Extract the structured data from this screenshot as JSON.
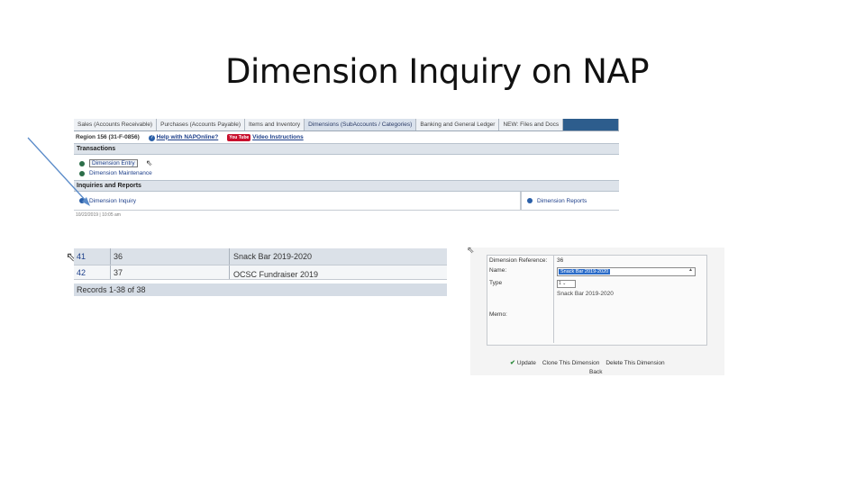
{
  "slide": {
    "title": "Dimension Inquiry on NAP"
  },
  "menu": {
    "tabs": [
      "Sales (Accounts Receivable)",
      "Purchases (Accounts Payable)",
      "Items and Inventory",
      "Dimensions (SubAccounts / Categories)",
      "Banking and General Ledger",
      "NEW: Files and Docs"
    ],
    "region": "Region 156 (31-F-0856)",
    "help_label": "Help with NAPOnline?",
    "yt_label": "You Tube",
    "video_label": "Video Instructions",
    "transactions_head": "Transactions",
    "dimension_entry": "Dimension Entry",
    "dimension_maintenance": "Dimension Maintenance",
    "inquiries_head": "Inquiries and Reports",
    "dimension_inquiry": "Dimension Inquiry",
    "dimension_reports": "Dimension Reports",
    "footer_date": "10/22/2019 | 10:05 am"
  },
  "records": {
    "rows": [
      {
        "id": "41",
        "code": "36",
        "name": "Snack Bar 2019-2020"
      },
      {
        "id": "42",
        "code": "37",
        "name": "OCSC Fundraiser 2019"
      }
    ],
    "footer": "Records 1-38 of 38"
  },
  "form": {
    "reference_label": "Dimension Reference:",
    "reference_value": "36",
    "name_label": "Name:",
    "name_value": "Snack Bar 2019-2020",
    "type_label": "Type",
    "type_value": "1",
    "memo_label": "Memo:",
    "memo_value": "Snack Bar 2019-2020",
    "update_label": "Update",
    "clone_label": "Clone This Dimension",
    "delete_label": "Delete This Dimension",
    "back_label": "Back"
  }
}
